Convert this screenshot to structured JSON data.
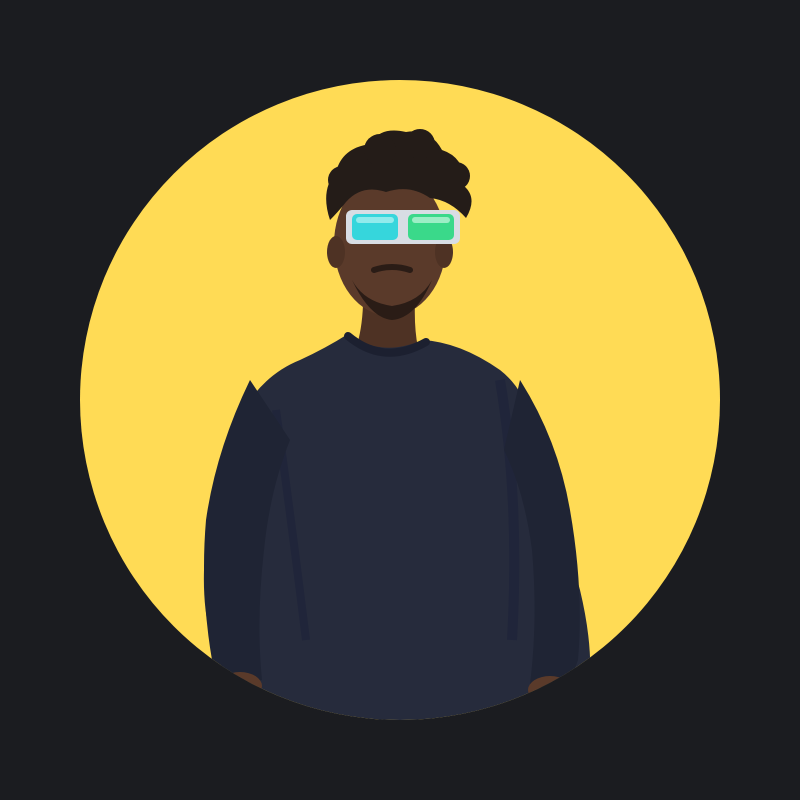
{
  "profile_avatar": {
    "kind": "circular profile photo",
    "colors": {
      "page_background": "#1b1c20",
      "circle_fill": "#ffdb55",
      "shirt": "#262b3c",
      "skin": "#5a3a2a",
      "hair": "#241c18",
      "lens": "#36d6dc"
    }
  }
}
